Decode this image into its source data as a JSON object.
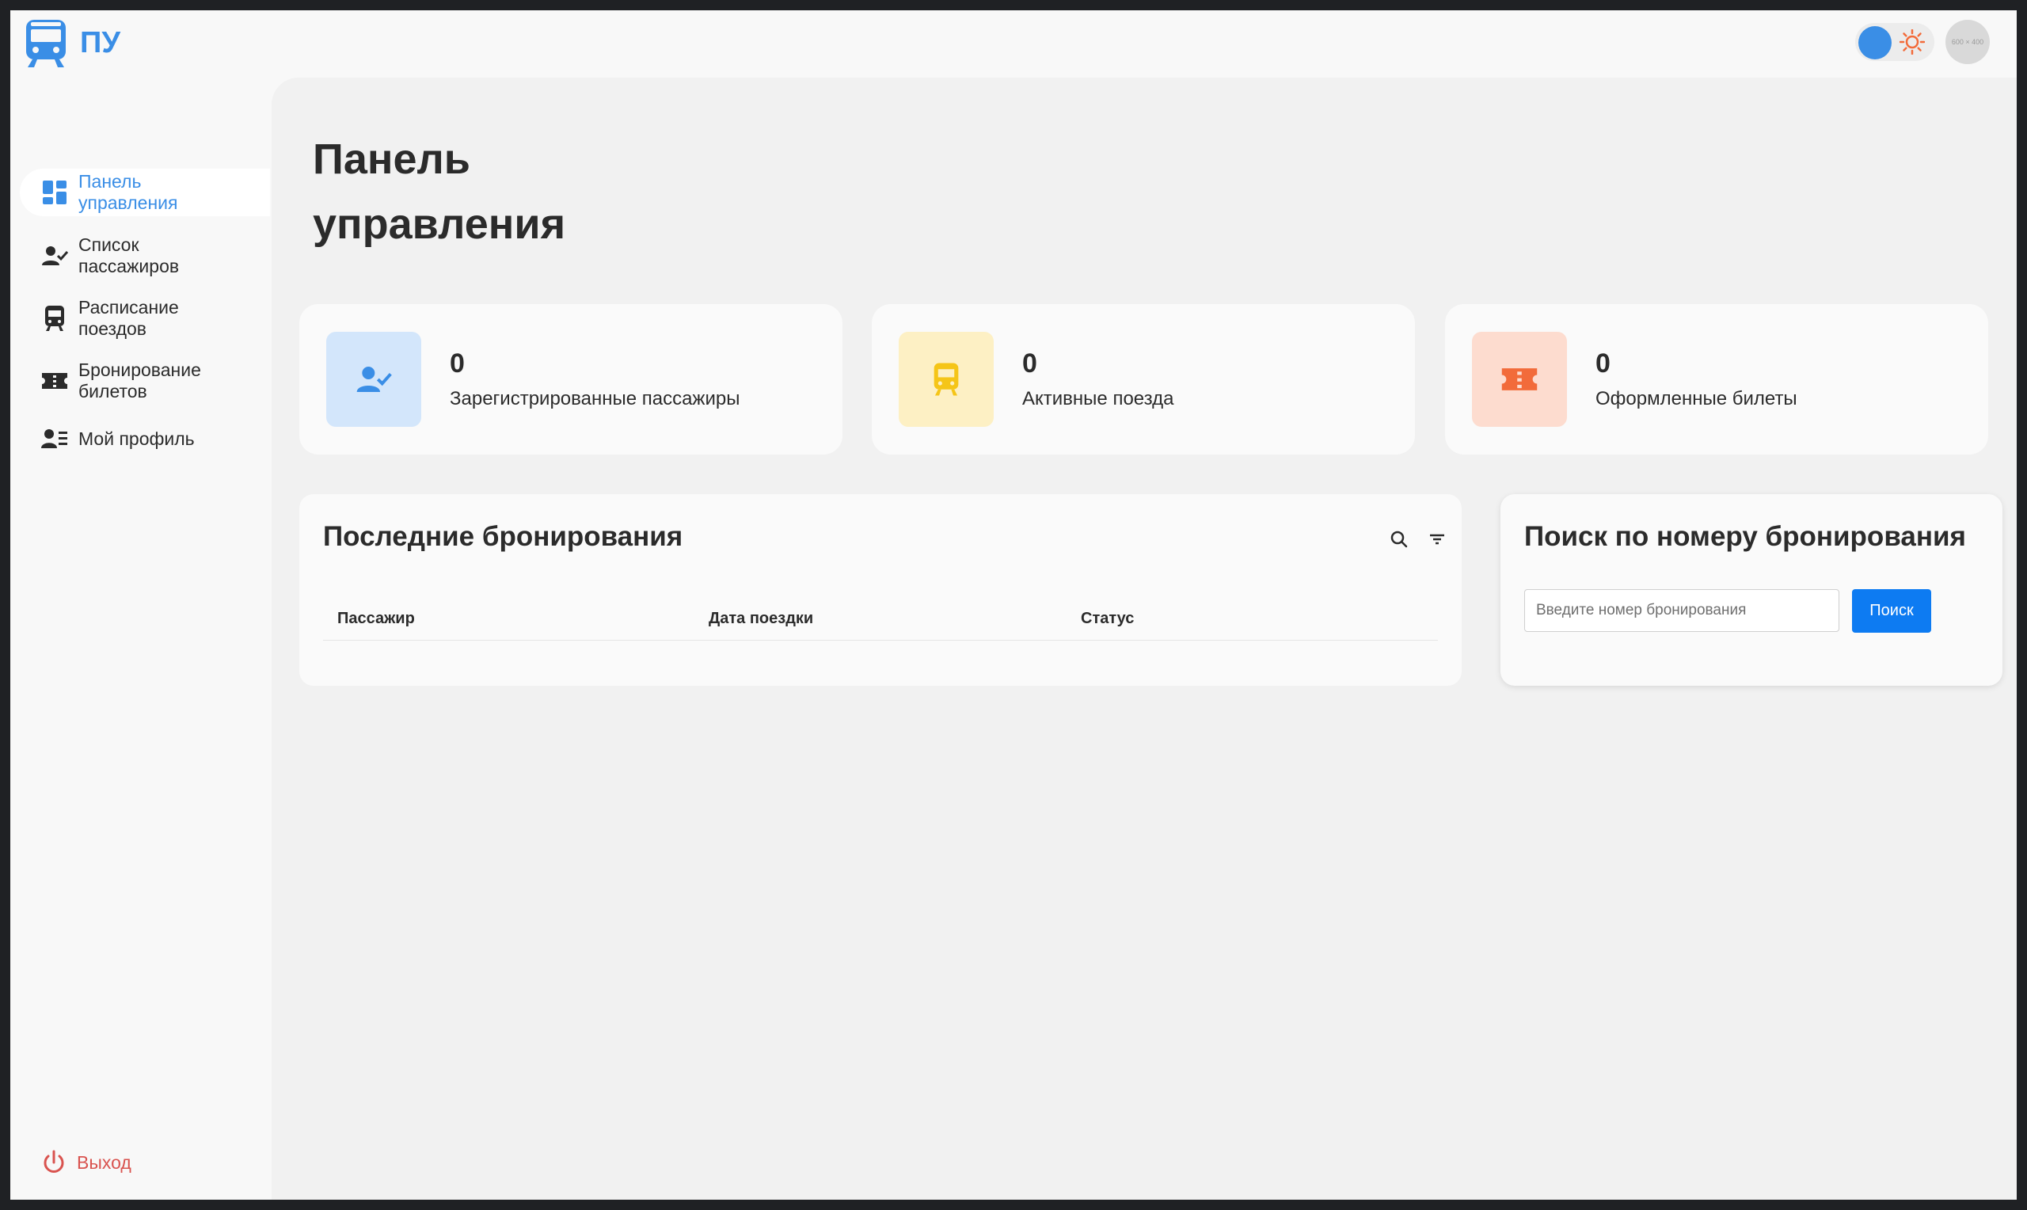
{
  "brand": {
    "name": "ПУ",
    "logo_icon": "train-icon",
    "color": "#3a8ee6"
  },
  "topbar": {
    "theme_toggle_icon": "sun-icon",
    "avatar_text": "600 × 400"
  },
  "sidebar": {
    "items": [
      {
        "label": "Панель управления",
        "icon": "dashboard-icon",
        "active": true
      },
      {
        "label": "Список пассажиров",
        "icon": "person-check-icon"
      },
      {
        "label": "Расписание поездов",
        "icon": "train-icon"
      },
      {
        "label": "Бронирование билетов",
        "icon": "ticket-icon"
      },
      {
        "label": "Мой профиль",
        "icon": "profile-list-icon"
      }
    ],
    "logout": {
      "label": "Выход",
      "icon": "power-icon",
      "color": "#d9534f"
    }
  },
  "page": {
    "title": "Панель управления"
  },
  "stats": [
    {
      "value": "0",
      "label": "Зарегистрированные пассажиры",
      "icon": "person-check-icon",
      "bg": "#d3e6fb",
      "color": "#3a8ee6"
    },
    {
      "value": "0",
      "label": "Активные поезда",
      "icon": "train-icon",
      "bg": "#fdf0c4",
      "color": "#f5c518"
    },
    {
      "value": "0",
      "label": "Оформленные билеты",
      "icon": "ticket-icon",
      "bg": "#fddccf",
      "color": "#f26b3a"
    }
  ],
  "recent_bookings": {
    "title": "Последние бронирования",
    "columns": [
      "Пассажир",
      "Дата поездки",
      "Статус"
    ],
    "rows": []
  },
  "booking_search": {
    "title": "Поиск по номеру бронирования",
    "placeholder": "Введите номер бронирования",
    "button_label": "Поиск"
  }
}
